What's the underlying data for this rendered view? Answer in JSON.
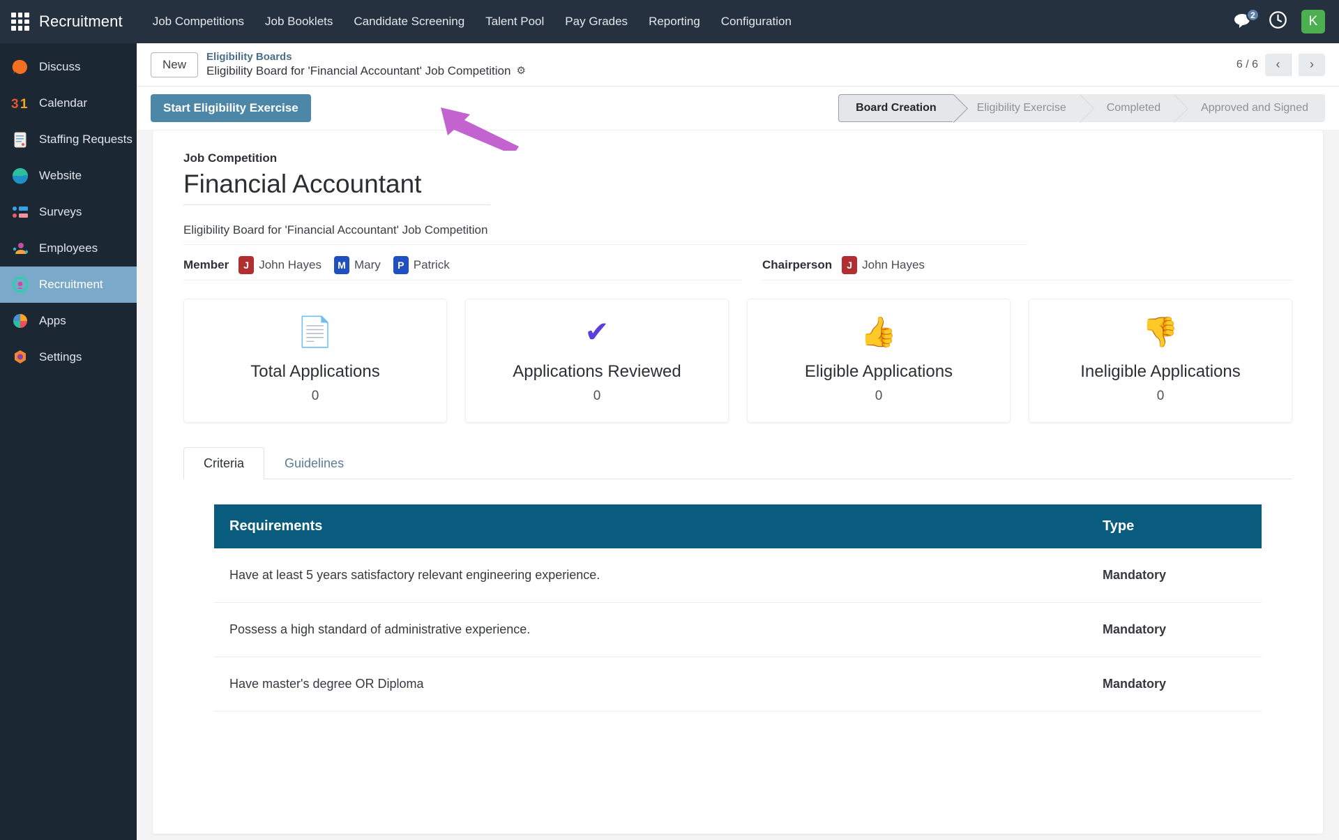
{
  "navbar": {
    "apps_icon": "apps-grid-icon",
    "brand": "Recruitment",
    "menu": [
      "Job Competitions",
      "Job Booklets",
      "Candidate Screening",
      "Talent Pool",
      "Pay Grades",
      "Reporting",
      "Configuration"
    ],
    "messages_icon": "messages-icon",
    "messages_count": "2",
    "activity_icon": "clock-activity-icon",
    "user_initial": "K"
  },
  "sidebar": {
    "items": [
      {
        "label": "Discuss",
        "icon": "discuss-icon",
        "active": false
      },
      {
        "label": "Calendar",
        "icon": "calendar-icon",
        "active": false
      },
      {
        "label": "Staffing Requests",
        "icon": "clipboard-icon",
        "active": false
      },
      {
        "label": "Website",
        "icon": "website-icon",
        "active": false
      },
      {
        "label": "Surveys",
        "icon": "surveys-icon",
        "active": false
      },
      {
        "label": "Employees",
        "icon": "employees-icon",
        "active": false
      },
      {
        "label": "Recruitment",
        "icon": "recruitment-icon",
        "active": true
      },
      {
        "label": "Apps",
        "icon": "apps-icon",
        "active": false
      },
      {
        "label": "Settings",
        "icon": "settings-icon",
        "active": false
      }
    ]
  },
  "control_panel": {
    "new_label": "New",
    "breadcrumb_root": "Eligibility Boards",
    "breadcrumb_current": "Eligibility Board for 'Financial Accountant' Job Competition",
    "gear_icon": "gear-icon",
    "pager_text": "6 / 6",
    "prev_icon": "chevron-left-icon",
    "next_icon": "chevron-right-icon"
  },
  "action_bar": {
    "start_button": "Start Eligibility Exercise",
    "annotation_icon": "pink-arrow-pointer",
    "stages": [
      {
        "label": "Board Creation",
        "active": true
      },
      {
        "label": "Eligibility Exercise",
        "active": false
      },
      {
        "label": "Completed",
        "active": false
      },
      {
        "label": "Approved and Signed",
        "active": false
      }
    ]
  },
  "form": {
    "job_competition_label": "Job Competition",
    "job_competition_value": "Financial Accountant",
    "description_value": "Eligibility Board for 'Financial Accountant' Job Competition",
    "member_label": "Member",
    "members": [
      {
        "initial": "J",
        "name": "John Hayes",
        "color": "#b22f31"
      },
      {
        "initial": "M",
        "name": "Mary",
        "color": "#2050c0"
      },
      {
        "initial": "P",
        "name": "Patrick",
        "color": "#2050c0"
      }
    ],
    "chairperson_label": "Chairperson",
    "chairperson": {
      "initial": "J",
      "name": "John Hayes",
      "color": "#b22f31"
    }
  },
  "stats": [
    {
      "icon": "document-page-icon",
      "glyph": "📄",
      "title": "Total Applications",
      "value": "0"
    },
    {
      "icon": "check-mark-icon",
      "glyph": "✔",
      "title": "Applications Reviewed",
      "value": "0"
    },
    {
      "icon": "thumbs-up-icon",
      "glyph": "👍",
      "title": "Eligible Applications",
      "value": "0"
    },
    {
      "icon": "thumbs-down-icon",
      "glyph": "👎",
      "title": "Ineligible Applications",
      "value": "0"
    }
  ],
  "tabs": [
    {
      "label": "Criteria",
      "active": true
    },
    {
      "label": "Guidelines",
      "active": false
    }
  ],
  "criteria_table": {
    "columns": [
      "Requirements",
      "Type"
    ],
    "rows": [
      {
        "requirement": "Have at least 5 years satisfactory relevant engineering experience.",
        "type": "Mandatory"
      },
      {
        "requirement": "Possess a high standard of administrative experience.",
        "type": "Mandatory"
      },
      {
        "requirement": "Have master's degree OR Diploma",
        "type": "Mandatory"
      }
    ]
  },
  "colors": {
    "navbar_bg": "#25313f",
    "sidebar_bg": "#1c2734",
    "sidebar_active": "#7aa9ca",
    "primary_button": "#4d87a8",
    "table_header": "#0a5c7e",
    "mandatory": "#f1442e",
    "breadcrumb_link": "#4a6e8a",
    "user_avatar": "#4caf50",
    "annotation_arrow": "#c263d0"
  }
}
